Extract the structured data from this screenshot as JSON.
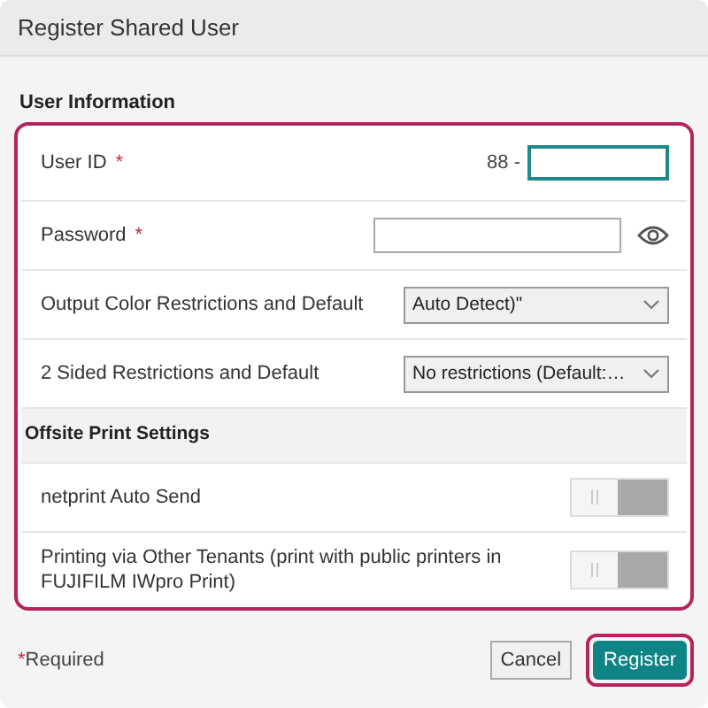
{
  "window": {
    "title": "Register Shared User"
  },
  "section_title": "User Information",
  "rows": [
    {
      "kind": "text",
      "label": "User ID",
      "required": true,
      "prefix": "88 -",
      "focused": true
    },
    {
      "kind": "password",
      "label": "Password",
      "required": true,
      "focused": false
    },
    {
      "kind": "select",
      "label": "Output Color Restrictions and Default",
      "required": false,
      "value": "Auto Detect)\""
    },
    {
      "kind": "select",
      "label": "2 Sided Restrictions and Default",
      "required": false,
      "value": "No restrictions (Default:…"
    },
    {
      "kind": "heading",
      "label": "Offsite Print Settings"
    },
    {
      "kind": "toggle",
      "label": "netprint Auto Send",
      "on": false
    },
    {
      "kind": "toggle",
      "label": "Printing via Other Tenants (print with public printers in FUJIFILM IWpro Print)",
      "on": false
    }
  ],
  "footer": {
    "required_mark": "*",
    "required_note": "Required"
  },
  "buttons": [
    {
      "kind": "secondary",
      "label": "Cancel"
    },
    {
      "kind": "primary",
      "label": "Register",
      "focused": true
    }
  ]
}
